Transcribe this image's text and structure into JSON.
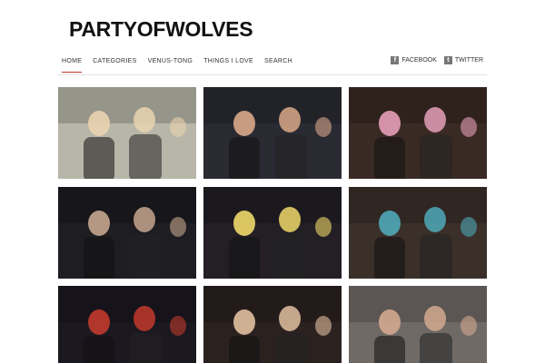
{
  "site": {
    "logo": "PARTYOFWOLVES"
  },
  "nav": {
    "items": [
      {
        "label": "HOME",
        "active": true
      },
      {
        "label": "CATEGORIES",
        "active": false
      },
      {
        "label": "VENUS-TONG",
        "active": false
      },
      {
        "label": "THINGS I LOVE",
        "active": false
      },
      {
        "label": "SEARCH",
        "active": false
      }
    ]
  },
  "social": {
    "facebook": {
      "label": "FACEBOOK",
      "icon": "facebook-icon"
    },
    "twitter": {
      "label": "TWITTER",
      "icon": "twitter-icon"
    }
  },
  "photos": [
    {
      "name": "photo-three-friends-graffiti",
      "bg": "#b8b6a8",
      "accent": "#e9d3b0"
    },
    {
      "name": "photo-two-men-posing",
      "bg": "#2a2a33",
      "accent": "#d9a98a"
    },
    {
      "name": "photo-pink-feather-costume",
      "bg": "#3a2a24",
      "accent": "#e59fb8"
    },
    {
      "name": "photo-hugging-couple",
      "bg": "#1d1d22",
      "accent": "#c7a68f"
    },
    {
      "name": "photo-blonde-superhero-costume",
      "bg": "#231f25",
      "accent": "#f0d86a"
    },
    {
      "name": "photo-pool-party",
      "bg": "#3b2f2a",
      "accent": "#4fa9b8"
    },
    {
      "name": "photo-red-dress-dancer",
      "bg": "#1b1820",
      "accent": "#c23a2c"
    },
    {
      "name": "photo-two-women-drinks",
      "bg": "#2b2220",
      "accent": "#e2c0a0"
    },
    {
      "name": "photo-woman-sunglasses",
      "bg": "#6f6a66",
      "accent": "#d3a98f"
    }
  ],
  "colors": {
    "accent": "#c0392b",
    "divider": "#e4e4e4"
  }
}
